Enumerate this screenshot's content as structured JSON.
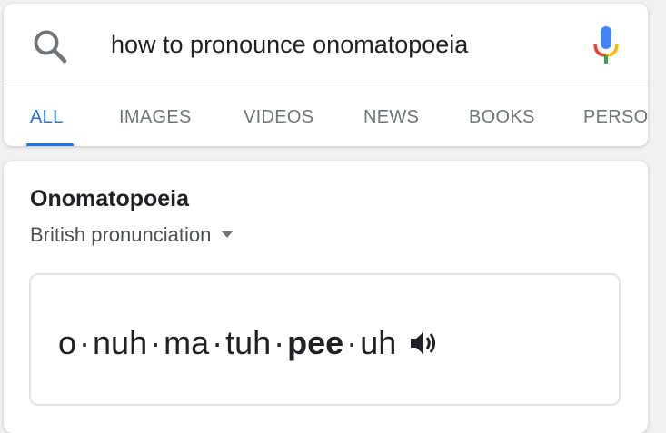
{
  "search": {
    "query": "how to pronounce onomatopoeia",
    "icon": "search-icon",
    "mic_icon": "mic-icon",
    "mic_colors": [
      "#4285f4",
      "#34a853",
      "#fbbc05",
      "#ea4335"
    ]
  },
  "tabs": [
    {
      "label": "ALL",
      "active": true
    },
    {
      "label": "IMAGES",
      "active": false
    },
    {
      "label": "VIDEOS",
      "active": false
    },
    {
      "label": "NEWS",
      "active": false
    },
    {
      "label": "BOOKS",
      "active": false
    },
    {
      "label": "PERSO",
      "active": false
    }
  ],
  "result": {
    "word": "Onomatopoeia",
    "accent_label": "British pronunciation",
    "syllables": [
      {
        "text": "o",
        "stressed": false
      },
      {
        "text": "nuh",
        "stressed": false
      },
      {
        "text": "ma",
        "stressed": false
      },
      {
        "text": "tuh",
        "stressed": false
      },
      {
        "text": "pee",
        "stressed": true
      },
      {
        "text": "uh",
        "stressed": false
      }
    ],
    "speaker_icon": "speaker-icon"
  },
  "colors": {
    "accent": "#1a73e8",
    "tab_inactive": "#70757a",
    "text": "#202124"
  }
}
